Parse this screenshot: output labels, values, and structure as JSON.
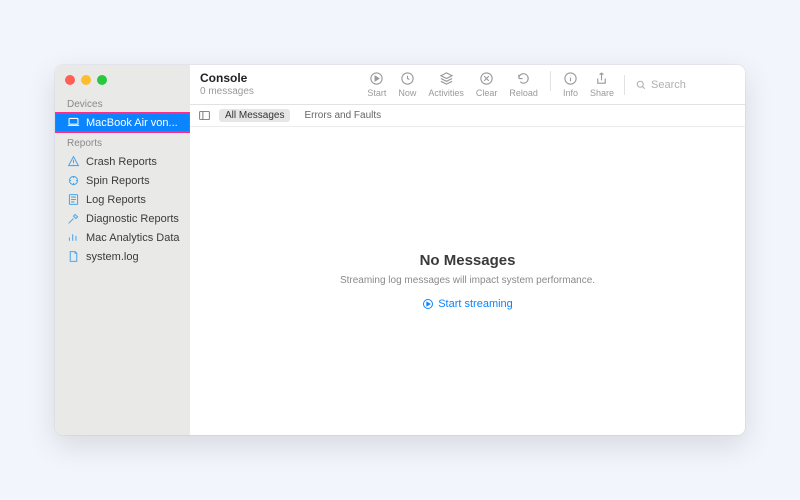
{
  "colors": {
    "accent": "#0a84ff",
    "highlight": "#ff2d87"
  },
  "sidebar": {
    "sections": [
      {
        "label": "Devices",
        "items": [
          {
            "name": "macbook-air",
            "icon": "laptop-icon",
            "label": "MacBook Air von...",
            "selected": true,
            "highlighted": true
          }
        ]
      },
      {
        "label": "Reports",
        "items": [
          {
            "name": "crash-reports",
            "icon": "warning-icon",
            "label": "Crash Reports"
          },
          {
            "name": "spin-reports",
            "icon": "spin-icon",
            "label": "Spin Reports"
          },
          {
            "name": "log-reports",
            "icon": "log-icon",
            "label": "Log Reports"
          },
          {
            "name": "diagnostic-reports",
            "icon": "tools-icon",
            "label": "Diagnostic Reports"
          },
          {
            "name": "mac-analytics",
            "icon": "analytics-icon",
            "label": "Mac Analytics Data"
          },
          {
            "name": "system-log",
            "icon": "file-icon",
            "label": "system.log"
          }
        ]
      }
    ]
  },
  "toolbar": {
    "title": "Console",
    "subtitle": "0 messages",
    "buttons": [
      {
        "name": "start",
        "label": "Start",
        "icon": "play-circle-icon"
      },
      {
        "name": "now",
        "label": "Now",
        "icon": "clock-icon"
      },
      {
        "name": "activities",
        "label": "Activities",
        "icon": "layers-icon"
      },
      {
        "name": "clear",
        "label": "Clear",
        "icon": "clear-icon"
      },
      {
        "name": "reload",
        "label": "Reload",
        "icon": "reload-icon"
      },
      {
        "name": "info",
        "label": "Info",
        "icon": "info-icon"
      },
      {
        "name": "share",
        "label": "Share",
        "icon": "share-icon"
      }
    ],
    "search_placeholder": "Search"
  },
  "filterbar": {
    "segments": [
      {
        "name": "all-messages",
        "label": "All Messages",
        "active": true
      },
      {
        "name": "errors-and-faults",
        "label": "Errors and Faults",
        "active": false
      }
    ]
  },
  "empty_state": {
    "headline": "No Messages",
    "sub": "Streaming log messages will impact system performance.",
    "action_label": "Start streaming"
  }
}
